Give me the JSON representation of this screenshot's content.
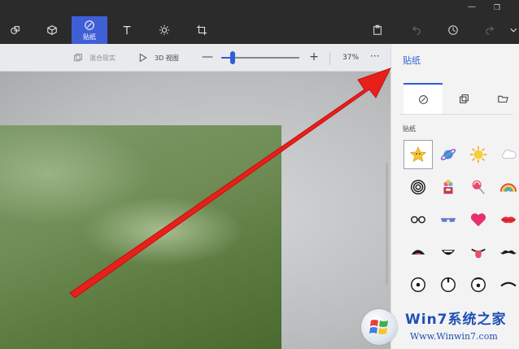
{
  "toolbar": {
    "tools": [
      {
        "name": "2d-shapes",
        "label": ""
      },
      {
        "name": "3d-shapes",
        "label": ""
      },
      {
        "name": "stickers",
        "label": "贴纸"
      },
      {
        "name": "text",
        "label": ""
      },
      {
        "name": "effects",
        "label": ""
      },
      {
        "name": "canvas",
        "label": ""
      }
    ],
    "active_tool": "stickers",
    "active_color": "#3f5fd6"
  },
  "subbar": {
    "mixed_reality_label": "混合现实",
    "view_3d_label": "3D 视图",
    "zoom_minus": "—",
    "zoom_plus": "+",
    "zoom_percent": 0.37,
    "zoom_value": "37%",
    "more": "···"
  },
  "panel": {
    "title": "贴纸",
    "tabs": [
      "sticker-tab",
      "texture-tab",
      "custom-sticker-tab"
    ],
    "section_label": "贴纸",
    "stickers": [
      [
        "star-sticker",
        "planet-sticker",
        "sun-sticker",
        "cloud-sticker"
      ],
      [
        "spiral-sticker",
        "bouquet-sticker",
        "lollipop-sticker",
        "rainbow-sticker"
      ],
      [
        "glasses-sticker",
        "sunglasses-sticker",
        "heart-sticker",
        "lips-sticker"
      ],
      [
        "open-mouth-sticker",
        "grin-mouth-sticker",
        "tongue-mouth-sticker",
        "mustache-sticker"
      ],
      [
        "eye-sticker",
        "eye-up-sticker",
        "eye-side-sticker",
        "eyebrow-sticker"
      ]
    ]
  },
  "watermark": {
    "title": "Win7系统之家",
    "url": "Www.Winwin7.com"
  },
  "colors": {
    "accent": "#2f5fd6",
    "arrow": "#e8201a"
  }
}
